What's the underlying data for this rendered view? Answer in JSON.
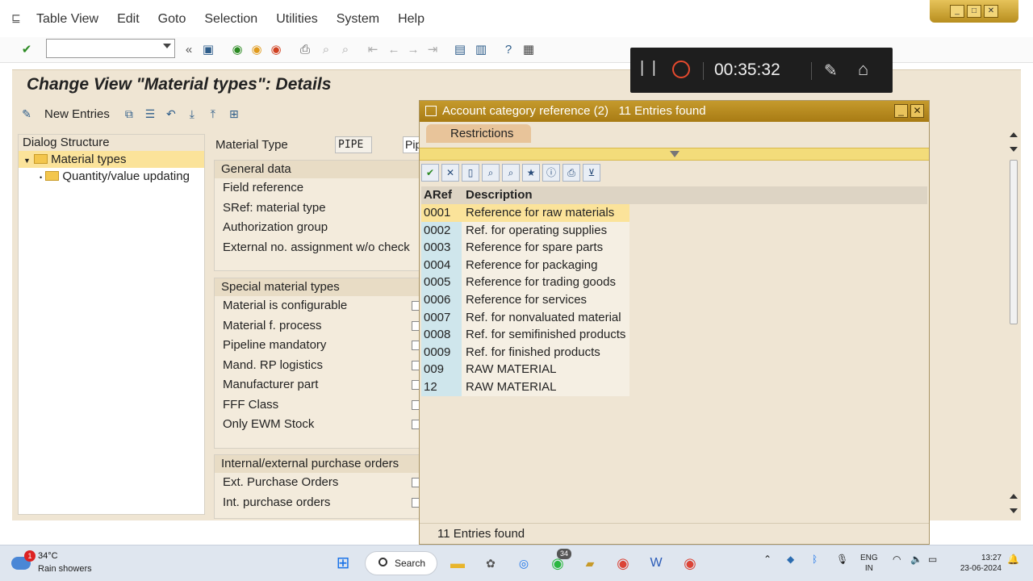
{
  "menu": {
    "items": [
      "Table View",
      "Edit",
      "Goto",
      "Selection",
      "Utilities",
      "System",
      "Help"
    ]
  },
  "recorder": {
    "time": "00:35:32"
  },
  "page": {
    "title": "Change View \"Material types\": Details",
    "new_entries_label": "New Entries"
  },
  "dialog_structure": {
    "heading": "Dialog Structure",
    "nodes": [
      "Material types",
      "Quantity/value updating"
    ]
  },
  "detail": {
    "material_type_label": "Material Type",
    "material_type_value": "PIPE",
    "material_type_desc": "Pip",
    "general_data": {
      "title": "General data",
      "rows": [
        "Field reference",
        "SRef: material type",
        "Authorization group",
        "External no. assignment w/o check"
      ]
    },
    "special": {
      "title": "Special material types",
      "rows": [
        "Material is configurable",
        "Material f. process",
        "Pipeline mandatory",
        "Mand. RP logistics",
        "Manufacturer part",
        "FFF Class",
        "Only EWM Stock"
      ]
    },
    "purchase": {
      "title": "Internal/external purchase orders",
      "rows": [
        "Ext. Purchase Orders",
        "Int. purchase orders"
      ]
    }
  },
  "popup": {
    "title": "Account category reference (2)   11 Entries found",
    "tab": "Restrictions",
    "columns": [
      "ARef",
      "Description"
    ],
    "rows": [
      [
        "0001",
        "Reference for raw materials"
      ],
      [
        "0002",
        "Ref. for operating supplies"
      ],
      [
        "0003",
        "Reference for spare parts"
      ],
      [
        "0004",
        "Reference for packaging"
      ],
      [
        "0005",
        "Reference for trading goods"
      ],
      [
        "0006",
        "Reference for services"
      ],
      [
        "0007",
        "Ref. for nonvaluated material"
      ],
      [
        "0008",
        "Ref. for semifinished products"
      ],
      [
        "0009",
        "Ref. for finished products"
      ],
      [
        "009",
        "RAW MATERIAL"
      ],
      [
        "12",
        "RAW MATERIAL"
      ]
    ],
    "status": "11 Entries found"
  },
  "taskbar": {
    "temperature": "34°C",
    "condition": "Rain showers",
    "weather_badge": "1",
    "search": "Search",
    "whatsapp_badge": "34",
    "lang_line1": "ENG",
    "lang_line2": "IN",
    "time": "13:27",
    "date": "23-06-2024"
  },
  "colors": {
    "sap_beige": "#efe5d3",
    "title_gold": "#b88e1e",
    "selection_yellow": "#fbe39a",
    "key_column_blue": "#cfe6ec"
  }
}
